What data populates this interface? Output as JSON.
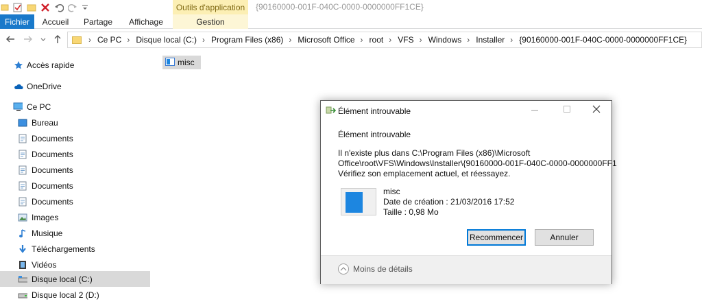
{
  "window": {
    "title": "{90160000-001F-040C-0000-0000000FF1CE}",
    "context_tab_group": "Outils d'application"
  },
  "ribbon": {
    "tabs": [
      "Fichier",
      "Accueil",
      "Partage",
      "Affichage",
      "Gestion"
    ]
  },
  "address": {
    "crumbs": [
      "Ce PC",
      "Disque local (C:)",
      "Program Files (x86)",
      "Microsoft Office",
      "root",
      "VFS",
      "Windows",
      "Installer",
      "{90160000-001F-040C-0000-0000000FF1CE}"
    ]
  },
  "sidebar": {
    "items": [
      {
        "label": "Accès rapide",
        "icon": "star-icon"
      },
      {
        "label": "OneDrive",
        "icon": "cloud-icon"
      },
      {
        "label": "Ce PC",
        "icon": "computer-icon"
      },
      {
        "label": "Bureau",
        "icon": "desktop-icon"
      },
      {
        "label": "Documents",
        "icon": "document-icon"
      },
      {
        "label": "Documents",
        "icon": "document-icon"
      },
      {
        "label": "Documents",
        "icon": "document-icon"
      },
      {
        "label": "Documents",
        "icon": "document-icon"
      },
      {
        "label": "Documents",
        "icon": "document-icon"
      },
      {
        "label": "Images",
        "icon": "pictures-icon"
      },
      {
        "label": "Musique",
        "icon": "music-icon"
      },
      {
        "label": "Téléchargements",
        "icon": "download-icon"
      },
      {
        "label": "Vidéos",
        "icon": "video-icon"
      },
      {
        "label": "Disque local (C:)",
        "icon": "drive-icon"
      },
      {
        "label": "Disque local 2 (D:)",
        "icon": "drive-icon"
      }
    ],
    "selected_index": 13
  },
  "content": {
    "files": [
      {
        "name": "misc"
      }
    ]
  },
  "dialog": {
    "title": "Élément introuvable",
    "heading": "Élément introuvable",
    "message_lines": [
      "Il n'existe plus dans C:\\Program Files (x86)\\Microsoft",
      "Office\\root\\VFS\\Windows\\Installer\\{90160000-001F-040C-0000-0000000FF1",
      "Vérifiez son emplacement actuel, et réessayez."
    ],
    "file_name": "misc",
    "created": "Date de création : 21/03/2016 17:52",
    "size": "Taille : 0,98 Mo",
    "retry_label": "Recommencer",
    "cancel_label": "Annuler",
    "details_label": "Moins de détails"
  },
  "colors": {
    "file_tab": "#1979ca",
    "context_tab": "#fcefb4",
    "selection": "#d9d9d9",
    "accent": "#0078d7"
  }
}
